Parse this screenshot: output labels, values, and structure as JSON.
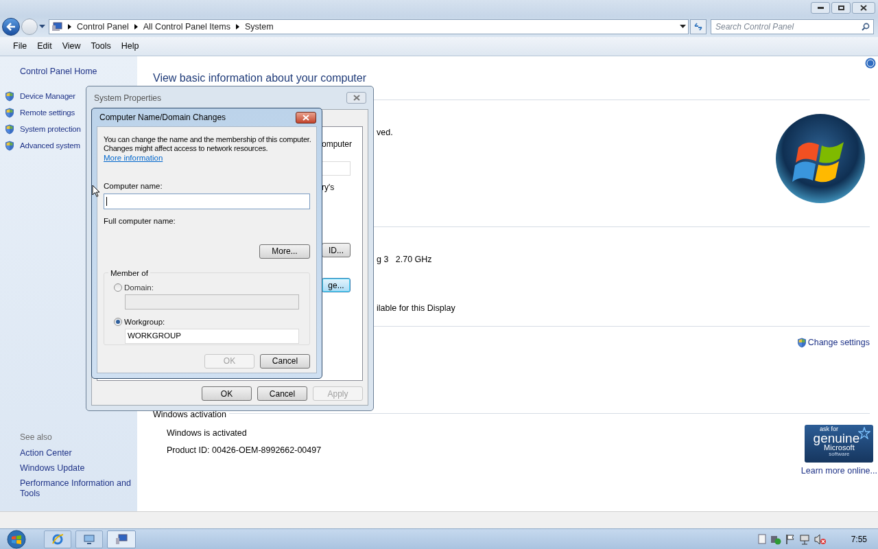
{
  "address_bar": {
    "breadcrumbs": [
      "Control Panel",
      "All Control Panel Items",
      "System"
    ]
  },
  "search": {
    "placeholder": "Search Control Panel"
  },
  "menu": [
    "File",
    "Edit",
    "View",
    "Tools",
    "Help"
  ],
  "sidebar": {
    "home": "Control Panel Home",
    "tasks": [
      "Device Manager",
      "Remote settings",
      "System protection",
      "Advanced system"
    ],
    "see_also_title": "See also",
    "see_also": [
      "Action Center",
      "Windows Update",
      "Performance Information and Tools"
    ]
  },
  "main": {
    "title": "View basic information about your computer",
    "edition_text": "ved.",
    "processor_text": "g 3   2.70 GHz",
    "pen_text": "ilable for this Display",
    "change_settings": "Change settings",
    "activation": {
      "heading": "Windows activation",
      "status": "Windows is activated",
      "product_id": "Product ID: 00426-OEM-8992662-00497"
    },
    "badge": [
      "ask for",
      "genuine",
      "Microsoft",
      "software"
    ],
    "learn_more": "Learn more online..."
  },
  "system_properties": {
    "title": "System Properties",
    "texts": [
      "omputer",
      "ry's"
    ],
    "page_buttons": [
      {
        "label": "ID...",
        "focused": false
      },
      {
        "label": "ge...",
        "focused": true
      }
    ],
    "buttons": [
      {
        "label": "OK",
        "disabled": false
      },
      {
        "label": "Cancel",
        "disabled": false
      },
      {
        "label": "Apply",
        "disabled": true
      }
    ]
  },
  "name_dialog": {
    "title": "Computer Name/Domain Changes",
    "description": "You can change the name and the membership of this computer. Changes might affect access to network resources.",
    "more_info": "More information",
    "computer_name_label": "Computer name:",
    "full_name_label": "Full computer name:",
    "more_button": "More...",
    "member_of": "Member of",
    "options": [
      {
        "label": "Domain:",
        "selected": false
      },
      {
        "label": "Workgroup:",
        "selected": true,
        "value": "WORKGROUP"
      }
    ],
    "buttons": [
      {
        "label": "OK",
        "disabled": true
      },
      {
        "label": "Cancel",
        "disabled": false
      }
    ]
  },
  "taskbar": {
    "clock": "7:55"
  }
}
